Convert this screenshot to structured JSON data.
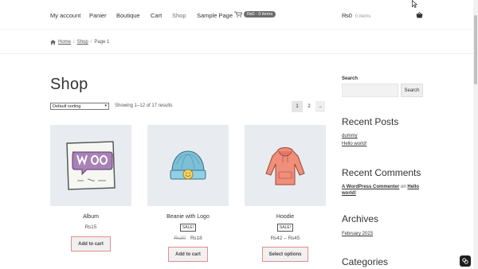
{
  "nav": {
    "items": [
      "My account",
      "Panier",
      "Boutique",
      "Cart",
      "Shop",
      "Sample Page"
    ],
    "cart_badge": "₨0 · 0 items",
    "header_total": "₨0",
    "header_items": "0 items"
  },
  "breadcrumb": {
    "home": "Home",
    "shop": "Shop",
    "page": "Page 1",
    "separator": "/"
  },
  "page_title": "Shop",
  "sorting": {
    "selected": "Default sorting",
    "result_count": "Showing 1–12 of 17 results"
  },
  "pagination": {
    "pages": [
      "1",
      "2"
    ],
    "next": "→",
    "current": "1"
  },
  "products": [
    {
      "name": "Album",
      "price": "₨15",
      "old_price": "",
      "sale": "",
      "button": "Add to cart",
      "icon": "album-icon"
    },
    {
      "name": "Beanie with Logo",
      "price": "₨18",
      "old_price": "₨20",
      "sale": "SALE!",
      "button": "Add to cart",
      "icon": "beanie-icon"
    },
    {
      "name": "Hoodie",
      "price": "₨42 – ₨45",
      "old_price": "",
      "sale": "SALE!",
      "button": "Select options",
      "icon": "hoodie-icon"
    }
  ],
  "sidebar": {
    "search_label": "Search",
    "search_button": "Search",
    "recent_posts_title": "Recent Posts",
    "recent_posts": [
      "dummy",
      "Hello world!"
    ],
    "recent_comments_title": "Recent Comments",
    "comment_author": "A WordPress Commenter",
    "comment_on": "on",
    "comment_post": "Hello world!",
    "archives_title": "Archives",
    "archives": [
      "February 2023"
    ],
    "categories_title": "Categories"
  },
  "colors": {
    "accent_border": "#e38d8d",
    "product_bg": "#e8ecf1",
    "badge_bg": "#6d6d6d"
  }
}
